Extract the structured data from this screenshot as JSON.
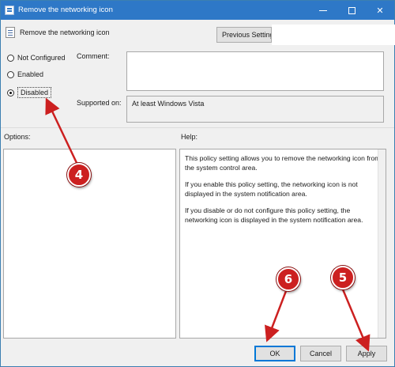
{
  "window": {
    "title": "Remove the networking icon",
    "controls": {
      "minimize": "–",
      "maximize": "□",
      "close": "✕"
    }
  },
  "header": {
    "policy_name": "Remove the networking icon",
    "previous_setting_label": "Previous Setting"
  },
  "state": {
    "options": [
      {
        "label": "Not Configured",
        "checked": false
      },
      {
        "label": "Enabled",
        "checked": false
      },
      {
        "label": "Disabled",
        "checked": true
      }
    ]
  },
  "fields": {
    "comment_label": "Comment:",
    "comment_value": "",
    "supported_label": "Supported on:",
    "supported_value": "At least Windows Vista"
  },
  "panes": {
    "options_label": "Options:",
    "help_label": "Help:",
    "help_paragraphs": [
      "This policy setting allows you to remove the networking icon from the system control area.",
      "If you enable this policy setting, the networking icon is not displayed in the system notification area.",
      "If you disable or do not configure this policy setting, the networking icon is displayed in the system notification area."
    ]
  },
  "buttons": {
    "ok": "OK",
    "cancel": "Cancel",
    "apply": "Apply"
  },
  "annotations": {
    "marker_4": "4",
    "marker_5": "5",
    "marker_6": "6"
  },
  "colors": {
    "titlebar": "#2e78c7",
    "marker": "#cc2020",
    "focus": "#0078d7"
  }
}
